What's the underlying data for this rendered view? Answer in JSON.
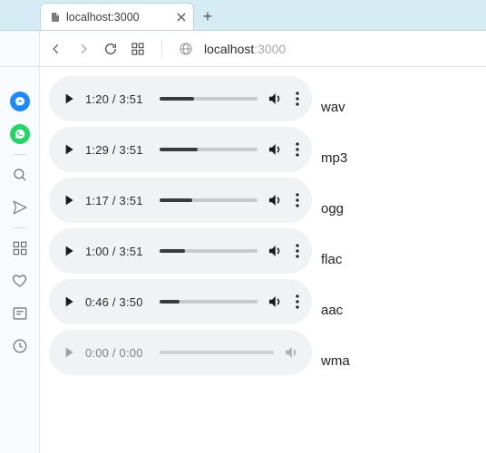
{
  "tab": {
    "title": "localhost:3000"
  },
  "address": {
    "domain": "localhost",
    "port": ":3000"
  },
  "sidebar": {
    "items": [
      {
        "name": "opera-logo-icon"
      },
      {
        "name": "messenger-icon"
      },
      {
        "name": "whatsapp-icon"
      },
      {
        "name": "search-icon"
      },
      {
        "name": "send-icon"
      },
      {
        "name": "speed-dial-icon"
      },
      {
        "name": "heart-icon"
      },
      {
        "name": "news-icon"
      },
      {
        "name": "history-icon"
      }
    ]
  },
  "players": [
    {
      "current": "1:20",
      "total": "3:51",
      "sep": " / ",
      "progress": 35,
      "label": "wav",
      "enabled": true
    },
    {
      "current": "1:29",
      "total": "3:51",
      "sep": " / ",
      "progress": 39,
      "label": "mp3",
      "enabled": true
    },
    {
      "current": "1:17",
      "total": "3:51",
      "sep": " / ",
      "progress": 33,
      "label": "ogg",
      "enabled": true
    },
    {
      "current": "1:00",
      "total": "3:51",
      "sep": " / ",
      "progress": 26,
      "label": "flac",
      "enabled": true
    },
    {
      "current": "0:46",
      "total": "3:50",
      "sep": " / ",
      "progress": 20,
      "label": "aac",
      "enabled": true
    },
    {
      "current": "0:00",
      "total": "0:00",
      "sep": " / ",
      "progress": 0,
      "label": "wma",
      "enabled": false
    }
  ]
}
